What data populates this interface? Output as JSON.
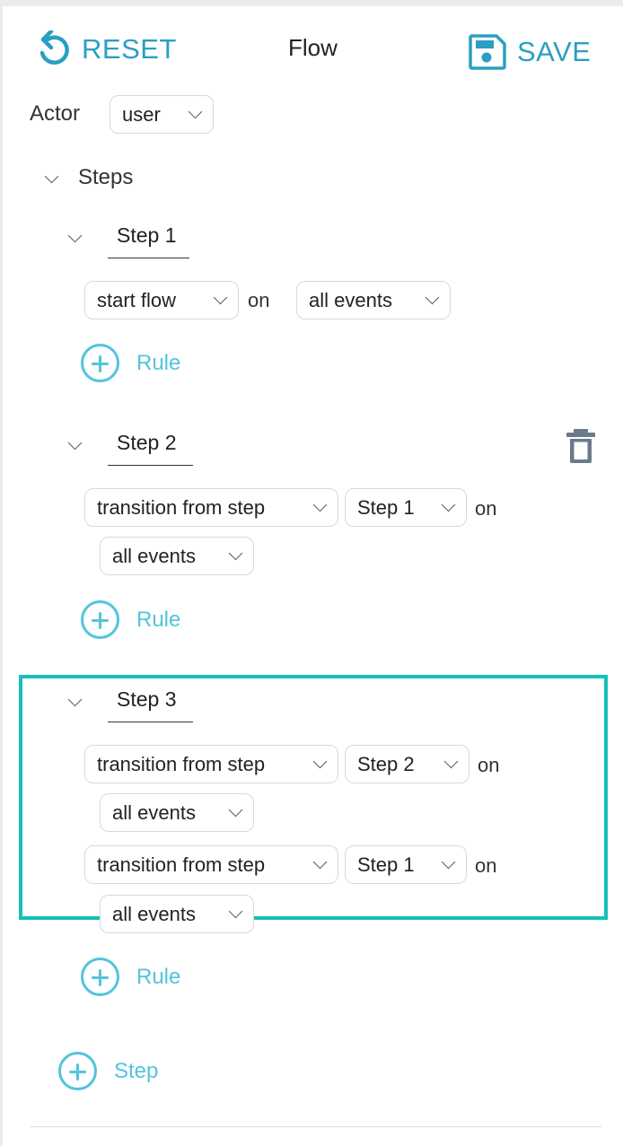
{
  "header": {
    "reset_label": "RESET",
    "title": "Flow",
    "save_label": "SAVE"
  },
  "actor": {
    "label": "Actor",
    "value": "user"
  },
  "steps_section": {
    "label": "Steps"
  },
  "steps": [
    {
      "name": "Step 1",
      "rules": [
        {
          "type": "start flow",
          "on_label": "on",
          "events": "all events"
        }
      ],
      "add_rule_label": "Rule"
    },
    {
      "name": "Step 2",
      "rules": [
        {
          "type": "transition from step",
          "from_step": "Step 1",
          "on_label": "on",
          "events": "all events"
        }
      ],
      "add_rule_label": "Rule"
    },
    {
      "name": "Step 3",
      "rules": [
        {
          "type": "transition from step",
          "from_step": "Step 2",
          "on_label": "on",
          "events": "all events"
        },
        {
          "type": "transition from step",
          "from_step": "Step 1",
          "on_label": "on",
          "events": "all events"
        }
      ],
      "add_rule_label": "Rule"
    }
  ],
  "add_step_label": "Step",
  "colors": {
    "accent": "#2a9fc2",
    "add_accent": "#52c4dd",
    "highlight_border": "#14c1b6",
    "delete_icon": "#6b7a8a"
  }
}
